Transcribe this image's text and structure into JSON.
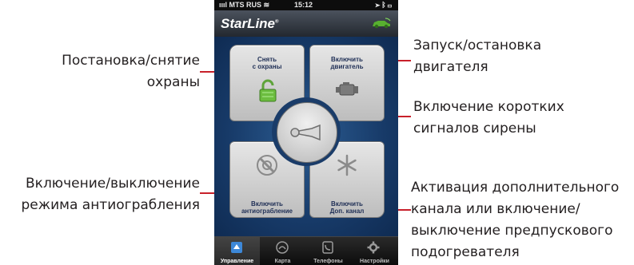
{
  "status_bar": {
    "carrier": "MTS RUS",
    "time": "15:12"
  },
  "app": {
    "logo": "StarLine"
  },
  "buttons": {
    "disarm": "Снять\nс охраны",
    "engine": "Включить\nдвигатель",
    "antirobbery": "Включить\nантиограбление",
    "extra_channel": "Включить\nДоп. канал"
  },
  "tabs": [
    "Управление",
    "Карта",
    "Телефоны",
    "Настройки"
  ],
  "callouts": {
    "arm": "Постановка/снятие\nохраны",
    "engine": "Запуск/остановка\nдвигателя",
    "siren": "Включение коротких\nсигналов сирены",
    "antirobbery": "Включение/выключение\nрежима антиограбления",
    "channel": "Активация дополнительного\nканала или включение/\nвыключение предпускового\nподогревателя"
  },
  "colors": {
    "callout_line": "#c8202a",
    "panel_blue": "#173a68",
    "accent_green": "#58b030"
  }
}
